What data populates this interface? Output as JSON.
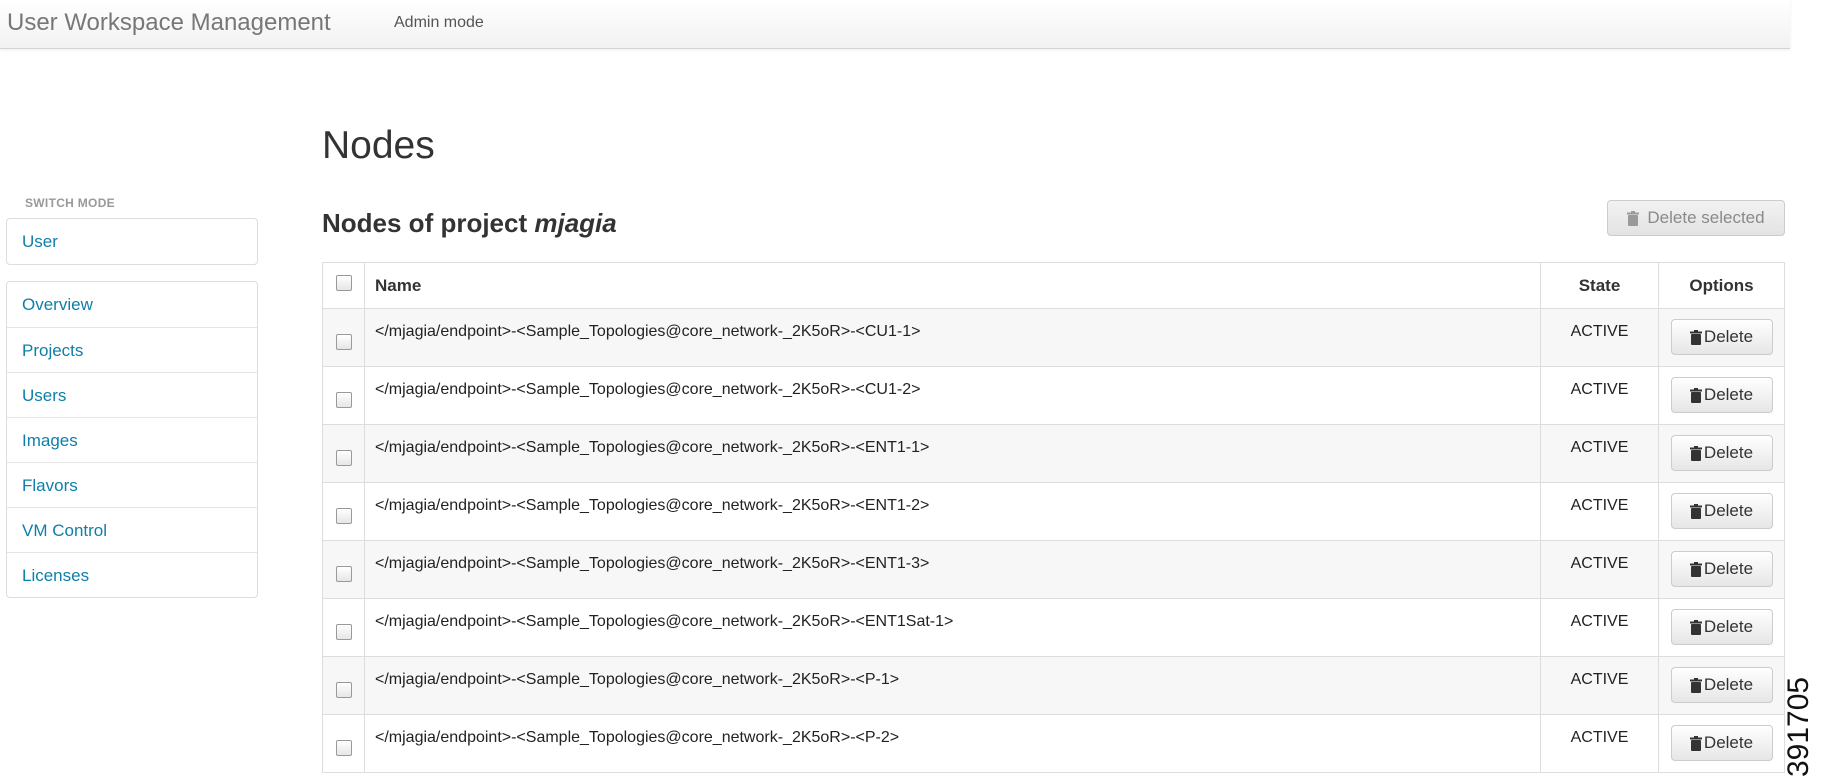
{
  "app": {
    "brand": "User Workspace Management",
    "mode_link": "Admin mode"
  },
  "sidebar": {
    "switch_mode_label": "SWITCH MODE",
    "mode_item": "User",
    "items": [
      {
        "label": "Overview"
      },
      {
        "label": "Projects"
      },
      {
        "label": "Users"
      },
      {
        "label": "Images"
      },
      {
        "label": "Flavors"
      },
      {
        "label": "VM Control"
      },
      {
        "label": "Licenses"
      }
    ]
  },
  "main": {
    "title": "Nodes",
    "subtitle_prefix": "Nodes of project ",
    "project_name": "mjagia",
    "delete_selected_label": "Delete selected",
    "table": {
      "headers": {
        "name": "Name",
        "state": "State",
        "options": "Options"
      },
      "delete_label": "Delete",
      "rows": [
        {
          "name": "</mjagia/endpoint>-<Sample_Topologies@core_network-_2K5oR>-<CU1-1>",
          "state": "ACTIVE"
        },
        {
          "name": "</mjagia/endpoint>-<Sample_Topologies@core_network-_2K5oR>-<CU1-2>",
          "state": "ACTIVE"
        },
        {
          "name": "</mjagia/endpoint>-<Sample_Topologies@core_network-_2K5oR>-<ENT1-1>",
          "state": "ACTIVE"
        },
        {
          "name": "</mjagia/endpoint>-<Sample_Topologies@core_network-_2K5oR>-<ENT1-2>",
          "state": "ACTIVE"
        },
        {
          "name": "</mjagia/endpoint>-<Sample_Topologies@core_network-_2K5oR>-<ENT1-3>",
          "state": "ACTIVE"
        },
        {
          "name": "</mjagia/endpoint>-<Sample_Topologies@core_network-_2K5oR>-<ENT1Sat-1>",
          "state": "ACTIVE"
        },
        {
          "name": "</mjagia/endpoint>-<Sample_Topologies@core_network-_2K5oR>-<P-1>",
          "state": "ACTIVE"
        },
        {
          "name": "</mjagia/endpoint>-<Sample_Topologies@core_network-_2K5oR>-<P-2>",
          "state": "ACTIVE"
        }
      ]
    }
  },
  "figure_number": "391705",
  "colors": {
    "link": "#0e7fa8",
    "stripe": "#f7f7f7",
    "border": "#dddddd"
  }
}
